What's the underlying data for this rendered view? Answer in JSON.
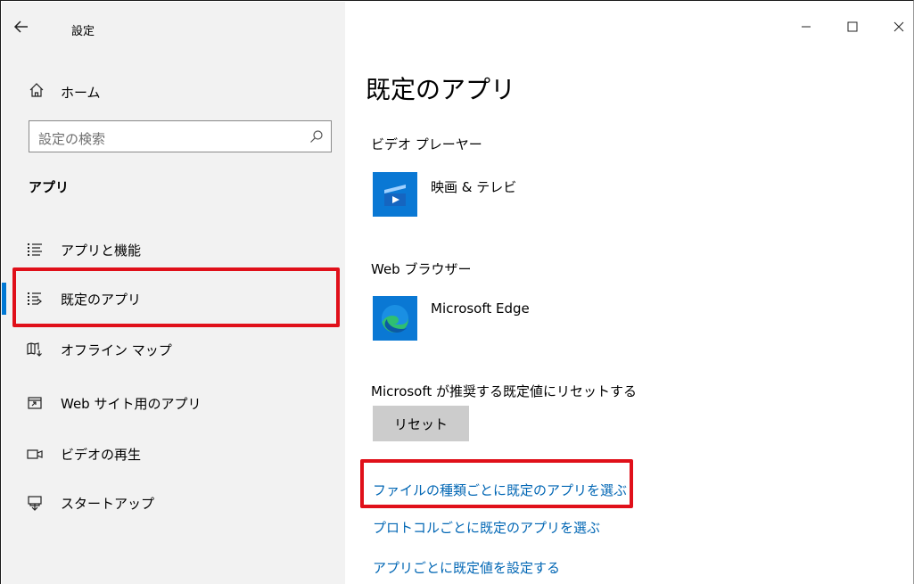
{
  "window": {
    "title": "設定",
    "controls": {
      "minimize": "–",
      "maximize": "☐",
      "close": "✕"
    }
  },
  "sidebar": {
    "home_label": "ホーム",
    "search_placeholder": "設定の検索",
    "section_header": "アプリ",
    "items": [
      {
        "label": "アプリと機能",
        "icon": "list-icon",
        "selected": false
      },
      {
        "label": "既定のアプリ",
        "icon": "list-default-icon",
        "selected": true
      },
      {
        "label": "オフライン マップ",
        "icon": "map-download-icon",
        "selected": false
      },
      {
        "label": "Web サイト用のアプリ",
        "icon": "open-external-icon",
        "selected": false
      },
      {
        "label": "ビデオの再生",
        "icon": "video-icon",
        "selected": false
      },
      {
        "label": "スタートアップ",
        "icon": "monitor-startup-icon",
        "selected": false
      }
    ]
  },
  "main": {
    "title": "既定のアプリ",
    "video_player": {
      "header": "ビデオ プレーヤー",
      "app": "映画 & テレビ"
    },
    "browser": {
      "header": "Web ブラウザー",
      "app": "Microsoft Edge"
    },
    "reset": {
      "text": "Microsoft が推奨する既定値にリセットする",
      "button": "リセット"
    },
    "links": [
      "ファイルの種類ごとに既定のアプリを選ぶ",
      "プロトコルごとに既定のアプリを選ぶ",
      "アプリごとに既定値を設定する"
    ]
  },
  "colors": {
    "accent": "#0078d4",
    "link": "#0066b4",
    "highlight": "#e0101a",
    "sidebar_bg": "#f2f2f2"
  }
}
